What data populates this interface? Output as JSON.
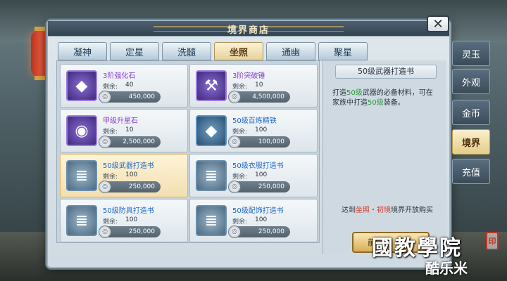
{
  "title": "境界商店",
  "tabs": [
    "凝神",
    "定星",
    "洗髓",
    "坐照",
    "通幽",
    "聚星"
  ],
  "active_tab": "坐照",
  "side_tabs": [
    "灵玉",
    "外观",
    "金币",
    "境界",
    "充值"
  ],
  "stock_label": "剩余:",
  "items": [
    {
      "name": "3阶强化石",
      "stock": "40",
      "price": "450,000"
    },
    {
      "name": "3阶突破锤",
      "stock": "10",
      "price": "4,500,000"
    },
    {
      "name": "甲级升星石",
      "stock": "10",
      "price": "2,500,000"
    },
    {
      "name": "50级百炼精铁",
      "stock": "100",
      "price": "100,000"
    },
    {
      "name": "50级武器打造书",
      "stock": "100",
      "price": "250,000"
    },
    {
      "name": "50级衣服打造书",
      "stock": "100",
      "price": "250,000"
    },
    {
      "name": "50级防具打造书",
      "stock": "100",
      "price": "250,000"
    },
    {
      "name": "50级配饰打造书",
      "stock": "100",
      "price": "250,000"
    }
  ],
  "detail": {
    "title": "50级武器打造书",
    "desc_1": "打造",
    "desc_hl1": "50级",
    "desc_2": "武器的必备材料，可在家族中打造",
    "desc_hl2": "50级",
    "desc_3": "装备。",
    "unlock_1": "达到",
    "unlock_red": "坐照・初境",
    "unlock_2": "境界开放购买",
    "buy_label": "前"
  },
  "watermark": "國教學院",
  "watermark_seal": "印",
  "watermark2": "酷乐米",
  "colors": {
    "accent": "#d9b86d",
    "name_purple": "#8b3fd0",
    "name_blue": "#1e68c8"
  }
}
